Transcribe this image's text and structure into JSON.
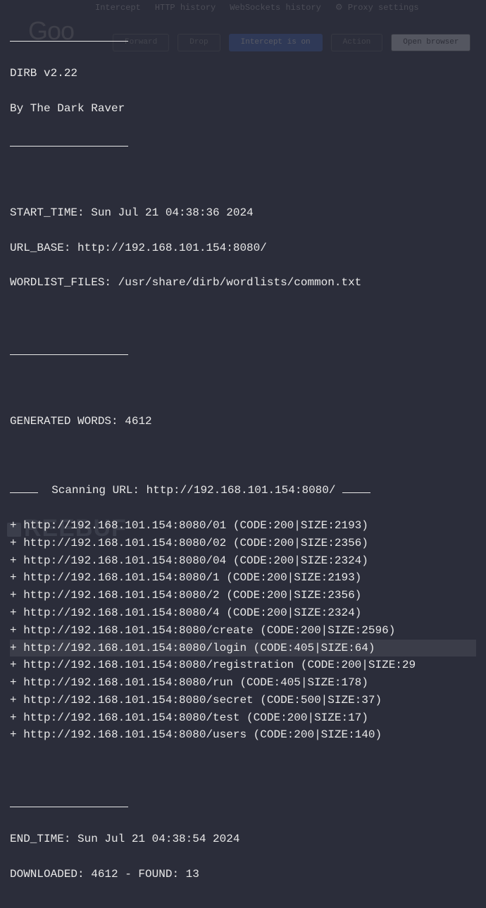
{
  "background": {
    "logo_fragment": "Goo",
    "tabs": [
      "Intercept",
      "HTTP history",
      "WebSockets history",
      "⚙ Proxy settings"
    ],
    "buttons": {
      "forward": "Forward",
      "drop": "Drop",
      "intercept": "Intercept is on",
      "action": "Action",
      "open_browser": "Open browser"
    }
  },
  "header": {
    "version_line": "DIRB v2.22",
    "author_line": "By The Dark Raver"
  },
  "info": {
    "start_time_label": "START_TIME: ",
    "start_time_value": "Sun Jul 21 04:38:36 2024",
    "url_base_label": "URL_BASE: ",
    "url_base_value": "http://192.168.101.154:8080/",
    "wordlist_label": "WORDLIST_FILES: ",
    "wordlist_value": "/usr/share/dirb/wordlists/common.txt"
  },
  "stats": {
    "generated_words_label": "GENERATED WORDS: ",
    "generated_words_value": "4612"
  },
  "scan": {
    "prefix_dash": "——  ",
    "scanning_label": "Scanning URL: ",
    "scanning_url": "http://192.168.101.154:8080/",
    "suffix_dash": " ——",
    "results": [
      "+ http://192.168.101.154:8080/01 (CODE:200|SIZE:2193)",
      "+ http://192.168.101.154:8080/02 (CODE:200|SIZE:2356)",
      "+ http://192.168.101.154:8080/04 (CODE:200|SIZE:2324)",
      "+ http://192.168.101.154:8080/1 (CODE:200|SIZE:2193)",
      "+ http://192.168.101.154:8080/2 (CODE:200|SIZE:2356)",
      "+ http://192.168.101.154:8080/4 (CODE:200|SIZE:2324)",
      "+ http://192.168.101.154:8080/create (CODE:200|SIZE:2596)",
      "+ http://192.168.101.154:8080/login (CODE:405|SIZE:64)",
      "+ http://192.168.101.154:8080/registration (CODE:200|SIZE:29",
      "+ http://192.168.101.154:8080/run (CODE:405|SIZE:178)",
      "+ http://192.168.101.154:8080/secret (CODE:500|SIZE:37)",
      "+ http://192.168.101.154:8080/test (CODE:200|SIZE:17)",
      "+ http://192.168.101.154:8080/users (CODE:200|SIZE:140)"
    ],
    "highlight_index": 7
  },
  "footer": {
    "end_time_label": "END_TIME: ",
    "end_time_value": "Sun Jul 21 04:38:54 2024",
    "downloaded_line": "DOWNLOADED: 4612 - FOUND: 13"
  },
  "watermark": "REEBUF"
}
